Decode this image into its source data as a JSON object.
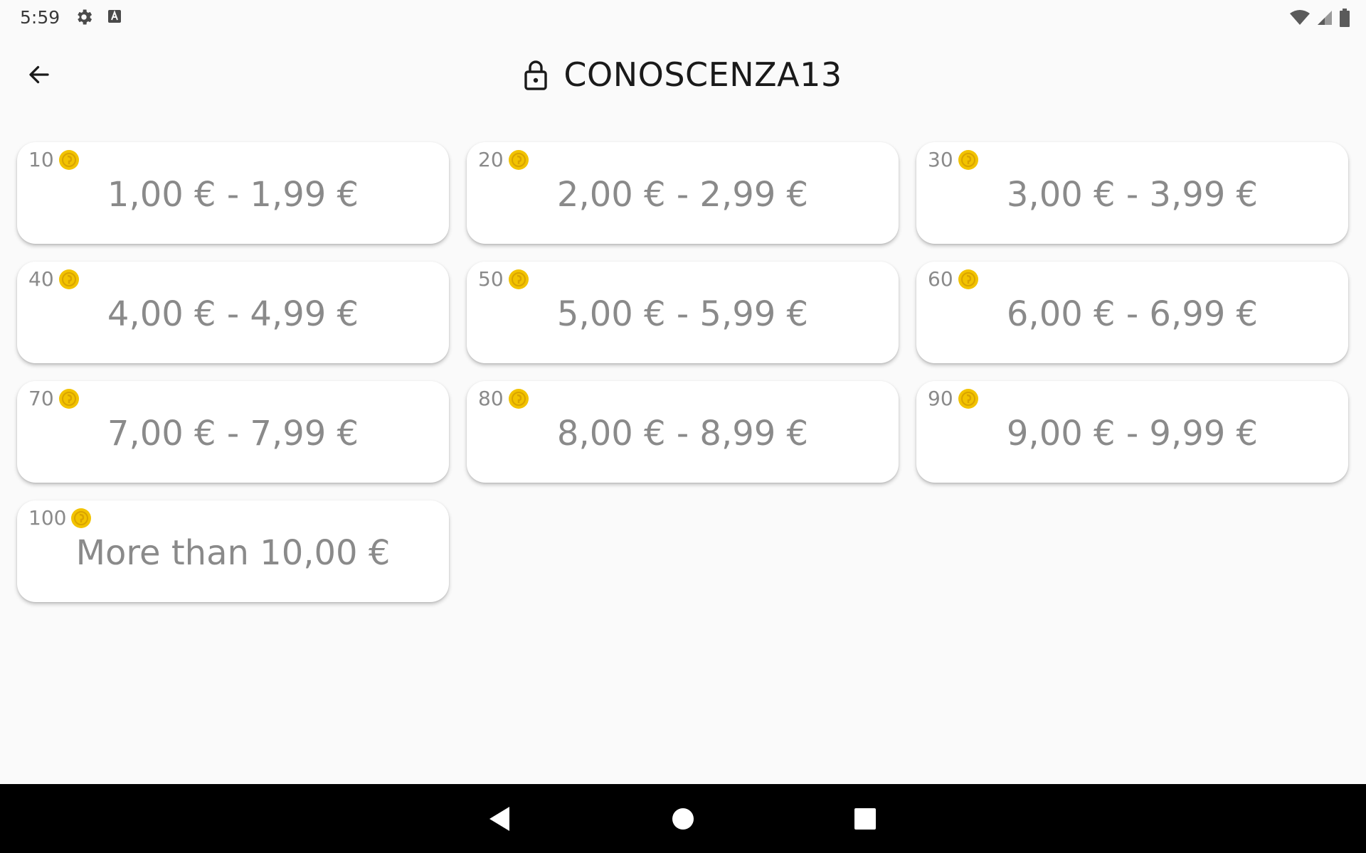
{
  "status": {
    "time": "5:59"
  },
  "header": {
    "title": "CONOSCENZA13"
  },
  "cards": [
    {
      "cost": "10",
      "price": "1,00 € - 1,99 €"
    },
    {
      "cost": "20",
      "price": "2,00 € - 2,99 €"
    },
    {
      "cost": "30",
      "price": "3,00 € - 3,99 €"
    },
    {
      "cost": "40",
      "price": "4,00 € - 4,99 €"
    },
    {
      "cost": "50",
      "price": "5,00 € - 5,99 €"
    },
    {
      "cost": "60",
      "price": "6,00 € - 6,99 €"
    },
    {
      "cost": "70",
      "price": "7,00 € - 7,99 €"
    },
    {
      "cost": "80",
      "price": "8,00 € - 8,99 €"
    },
    {
      "cost": "90",
      "price": "9,00 € - 9,99 €"
    },
    {
      "cost": "100",
      "price": "More than 10,00 €"
    }
  ],
  "icons": {
    "status_left": [
      "gear-icon",
      "keyboard-a-icon"
    ],
    "status_right": [
      "wifi-icon",
      "cell-signal-icon",
      "battery-icon"
    ],
    "header": [
      "back-arrow-icon",
      "lock-icon"
    ],
    "card": "coin-icon",
    "nav": [
      "nav-back-icon",
      "nav-home-icon",
      "nav-recents-icon"
    ]
  },
  "colors": {
    "coin": "#f2c300",
    "coin_inner": "#d9a300",
    "card_text": "#8a8a8a",
    "background": "#fafafa"
  }
}
